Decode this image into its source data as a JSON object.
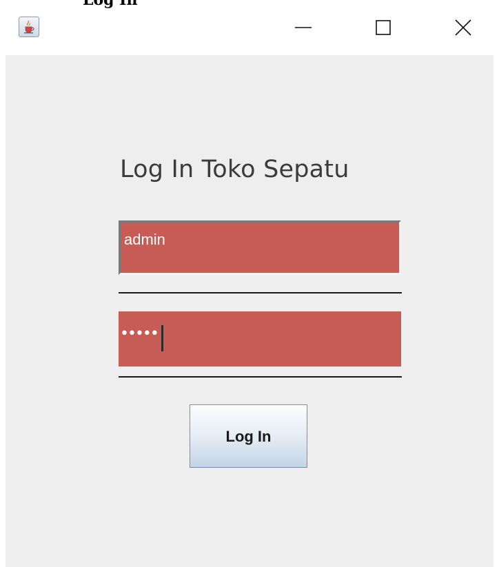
{
  "window": {
    "title": "Log In",
    "app_icon": "java-cup-icon",
    "controls": {
      "minimize_icon": "minimize-icon",
      "maximize_icon": "maximize-icon",
      "close_icon": "close-icon"
    }
  },
  "form": {
    "heading": "Log In Toko Sepatu",
    "username_value": "admin",
    "password_mask": "•••••",
    "login_label": "Log In"
  },
  "colors": {
    "field_background": "#c75b55",
    "panel_background": "#eeeeee",
    "heading_text": "#3b3b3b"
  }
}
